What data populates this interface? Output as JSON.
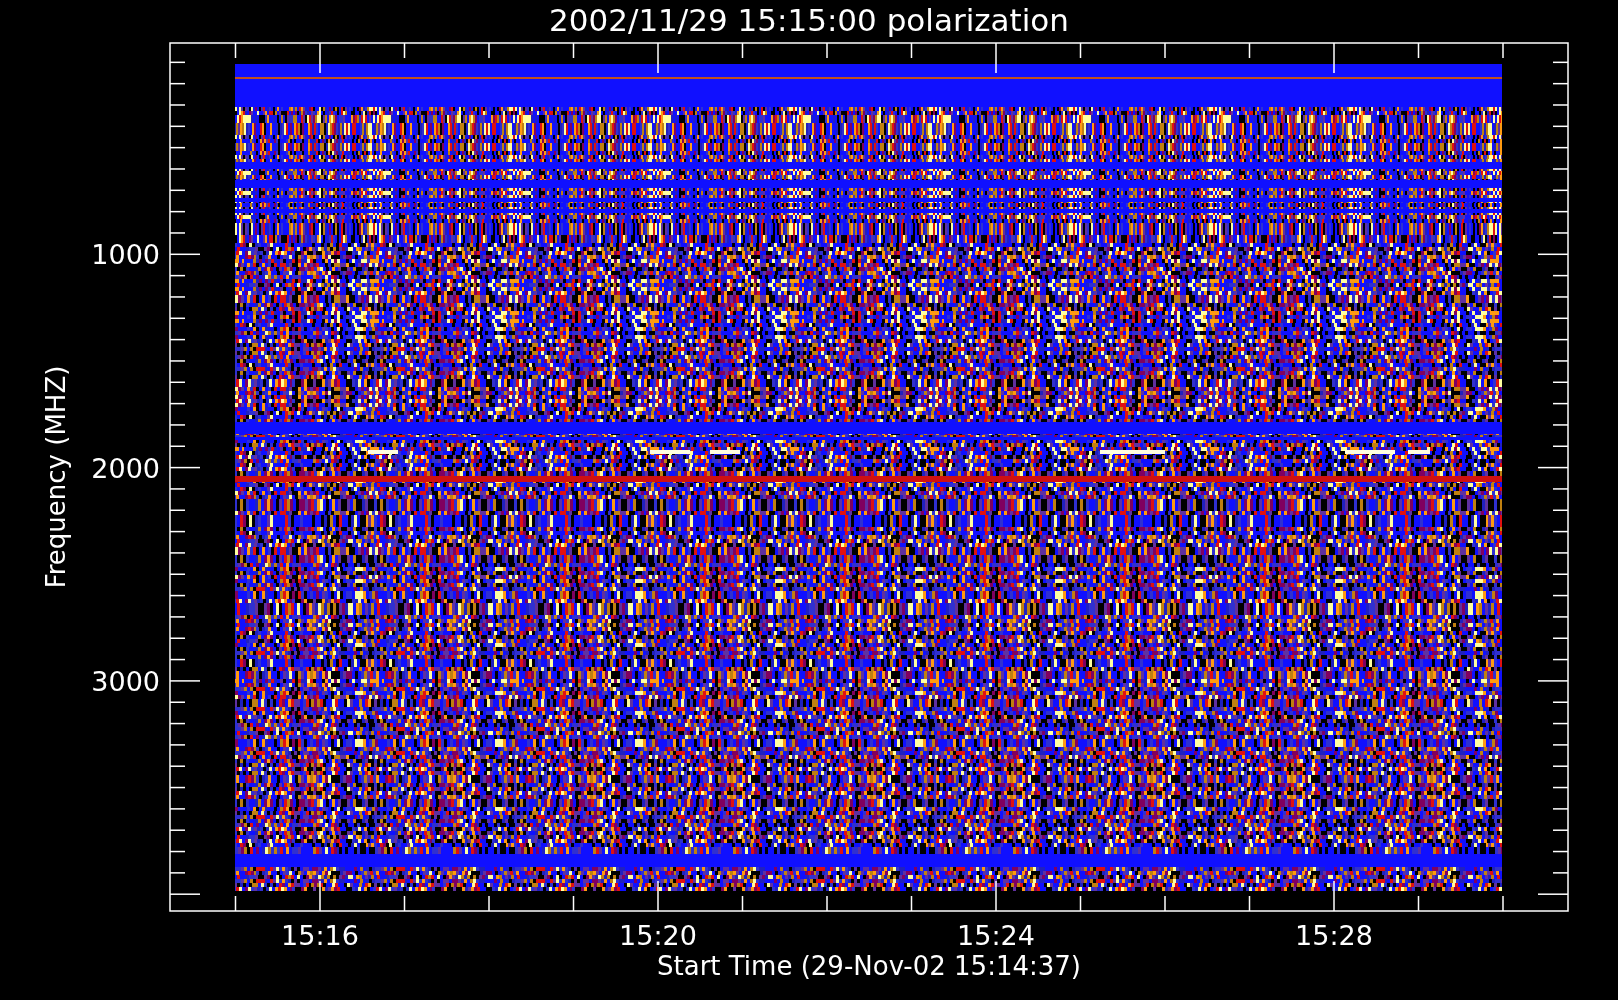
{
  "title": "2002/11/29 15:15:00 polarization",
  "y_axis": {
    "label": "Frequency (MHZ)",
    "tick_labels": [
      "1000",
      "2000",
      "3000"
    ]
  },
  "x_axis": {
    "label": "Start Time (29-Nov-02 15:14:37)",
    "tick_labels": [
      "15:16",
      "15:20",
      "15:24",
      "15:28"
    ]
  }
}
